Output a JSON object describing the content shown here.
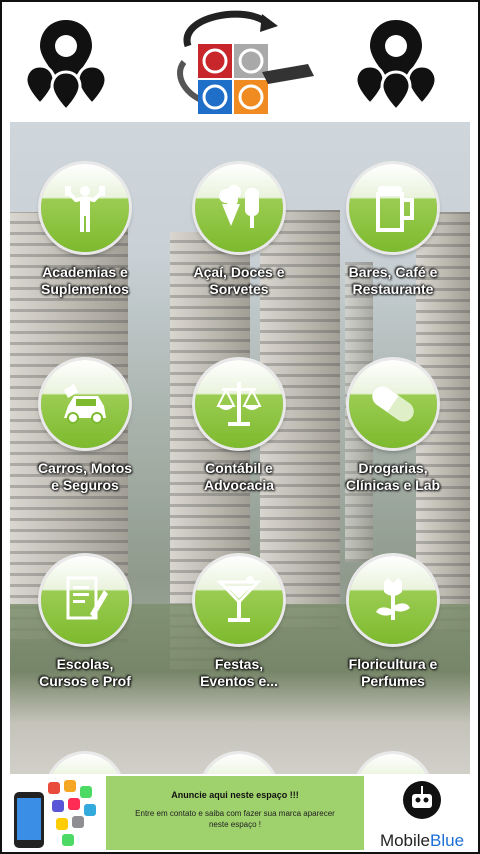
{
  "categories": [
    {
      "label_line1": "Academias e",
      "label_line2": "Suplementos",
      "icon": "fitness-icon"
    },
    {
      "label_line1": "Açaí, Doces e",
      "label_line2": "Sorvetes",
      "icon": "ice-cream-icon"
    },
    {
      "label_line1": "Bares, Café e",
      "label_line2": "Restaurante",
      "icon": "beer-mug-icon"
    },
    {
      "label_line1": "Carros, Motos",
      "label_line2": "e Seguros",
      "icon": "car-icon"
    },
    {
      "label_line1": "Contábil e",
      "label_line2": "Advocacia",
      "icon": "scales-icon"
    },
    {
      "label_line1": "Drogarias,",
      "label_line2": "Clínicas e Lab",
      "icon": "pill-icon"
    },
    {
      "label_line1": "Escolas,",
      "label_line2": "Cursos e Prof",
      "icon": "certificate-icon"
    },
    {
      "label_line1": "Festas,",
      "label_line2": "Eventos e...",
      "icon": "cocktail-icon"
    },
    {
      "label_line1": "Floricultura e",
      "label_line2": "Perfumes",
      "icon": "flower-icon"
    }
  ],
  "ad": {
    "title": "Anuncie aqui neste espaço !!!",
    "text": "Entre em contato e saiba com fazer sua marca aparecer neste espaço !",
    "brand_part1": "Mobile",
    "brand_part2": "Blue"
  },
  "colors": {
    "accent_green": "#7dba2e",
    "ad_green": "#9fd16c",
    "brand_blue": "#1b6fd6"
  }
}
